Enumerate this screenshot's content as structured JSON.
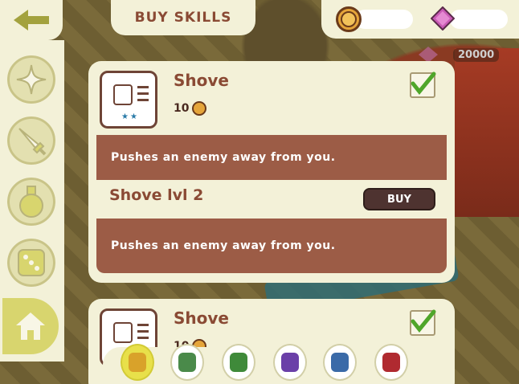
{
  "header": {
    "title": "BUY SKILLS",
    "back_icon": "back-arrow-icon"
  },
  "currency": {
    "coin_icon": "gold-coin-icon",
    "coin_value": "",
    "gem_icon": "pink-gem-icon",
    "gem_value": "",
    "gem_readout": "20000"
  },
  "sidebar": {
    "items": [
      {
        "icon": "sparkle-star-icon"
      },
      {
        "icon": "sword-icon"
      },
      {
        "icon": "potion-flask-icon"
      },
      {
        "icon": "dice-icon"
      },
      {
        "icon": "home-icon"
      }
    ]
  },
  "skills": [
    {
      "name": "Shove",
      "cost": "10",
      "checked": true,
      "description": "Pushes an enemy away from you.",
      "level_name": "Shove lvl 2",
      "buy_label": "BUY",
      "level_description": "Pushes an enemy away from you."
    },
    {
      "name": "Shove",
      "cost": "10",
      "checked": true
    }
  ],
  "heroes": [
    {
      "name": "hero-trident-warrior",
      "color": "#d9a22a"
    },
    {
      "name": "hero-green-knight",
      "color": "#4a8a4a"
    },
    {
      "name": "hero-archer",
      "color": "#3f8a3a"
    },
    {
      "name": "hero-purple-wizard",
      "color": "#6a3fa8"
    },
    {
      "name": "hero-blue-knight",
      "color": "#3a6aa8"
    },
    {
      "name": "hero-vampire",
      "color": "#b02a30"
    }
  ],
  "colors": {
    "panel": "#f3f1d8",
    "band": "#9c5c46",
    "title_text": "#8a4a34",
    "check": "#4fa62a"
  }
}
